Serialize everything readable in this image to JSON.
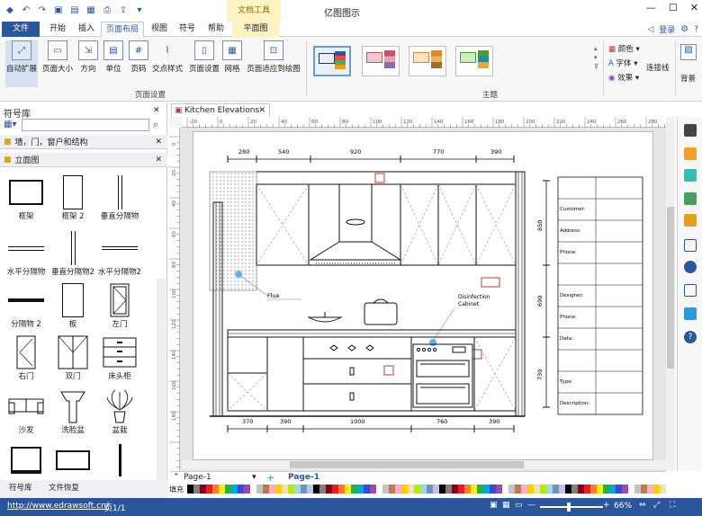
{
  "app": {
    "title": "亿图图示",
    "context_tab": "文档工具",
    "context_subtab": "平面图"
  },
  "tabs": [
    "文件",
    "开始",
    "插入",
    "页面布局",
    "视图",
    "符号",
    "帮助"
  ],
  "topright": {
    "login": "登录"
  },
  "ribbon": {
    "buttons": [
      "自动扩展",
      "页面大小",
      "方向",
      "单位",
      "页码",
      "交点样式",
      "页面设置",
      "网格",
      "页面适应到绘图"
    ],
    "group_page_setup": "页面设置",
    "group_theme": "主题",
    "theme_options": [
      "颜色",
      "字体",
      "效果"
    ],
    "connector": "连接线",
    "background": "背景"
  },
  "library": {
    "title": "符号库",
    "section1": "墙，门，窗户和结构",
    "section2": "立面图",
    "items": [
      "框架",
      "框架 2",
      "垂直分隔物",
      "水平分隔物",
      "垂直分隔物2",
      "水平分隔物2",
      "分隔物 2",
      "板",
      "左门",
      "右门",
      "双门",
      "床头柜",
      "沙发",
      "洗脸盆",
      "盆栽"
    ],
    "bottom_tabs": [
      "符号库",
      "文件恢复"
    ]
  },
  "document": {
    "tab_name": "Kitchen Elevations",
    "ruler_top": [
      "-20",
      "0",
      "20",
      "40",
      "60",
      "80",
      "100",
      "120",
      "140",
      "160",
      "180",
      "200",
      "220",
      "240",
      "260",
      "280"
    ],
    "ruler_left": [
      "0",
      "20",
      "40",
      "60",
      "80",
      "100",
      "120",
      "140",
      "160",
      "180"
    ],
    "dims_top": [
      "280",
      "540",
      "920",
      "770",
      "390"
    ],
    "dims_bottom": [
      "370",
      "390",
      "1000",
      "760",
      "390"
    ],
    "dims_right": [
      "850",
      "690",
      "730"
    ],
    "annotations": {
      "flue": "Flue",
      "disinfection": "Disinfection\nCabinet"
    },
    "info_fields": [
      "Customer:",
      "Address:",
      "Phone:",
      "Designer:",
      "Phone:",
      "Data:",
      "Type:",
      "Description:"
    ]
  },
  "pages": {
    "current": "Page-1",
    "tab": "Page-1"
  },
  "fill_label": "填充",
  "status": {
    "url": "http://www.edrawsoft.cn/",
    "page": "页1/1",
    "zoom": "66%"
  },
  "colors": {
    "accent": "#2b579a",
    "context": "#fdf3c5",
    "palette": [
      "#000000",
      "#7f7f7f",
      "#880015",
      "#ed1c24",
      "#ff7f27",
      "#fff200",
      "#22b14c",
      "#00a2e8",
      "#3f48cc",
      "#a349a4",
      "#ffffff",
      "#c3c3c3",
      "#b97a57",
      "#ffaec9",
      "#ffc90e",
      "#efe4b0",
      "#b5e61d",
      "#99d9ea",
      "#7092be",
      "#c8bfe7"
    ]
  }
}
